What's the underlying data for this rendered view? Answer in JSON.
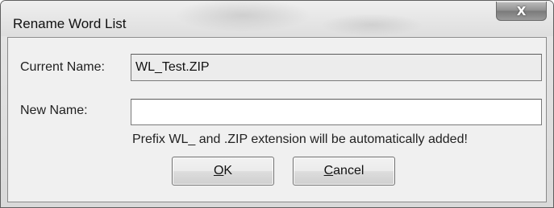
{
  "window": {
    "title": "Rename Word List",
    "close_glyph": "X"
  },
  "form": {
    "current_name_label": "Current Name:",
    "current_name_value": "WL_Test.ZIP",
    "new_name_label": "New Name:",
    "new_name_value": "",
    "hint": "Prefix WL_ and .ZIP extension will be automatically added!"
  },
  "buttons": {
    "ok": {
      "accel": "O",
      "rest": "K"
    },
    "cancel": {
      "accel": "C",
      "rest": "ancel"
    }
  }
}
